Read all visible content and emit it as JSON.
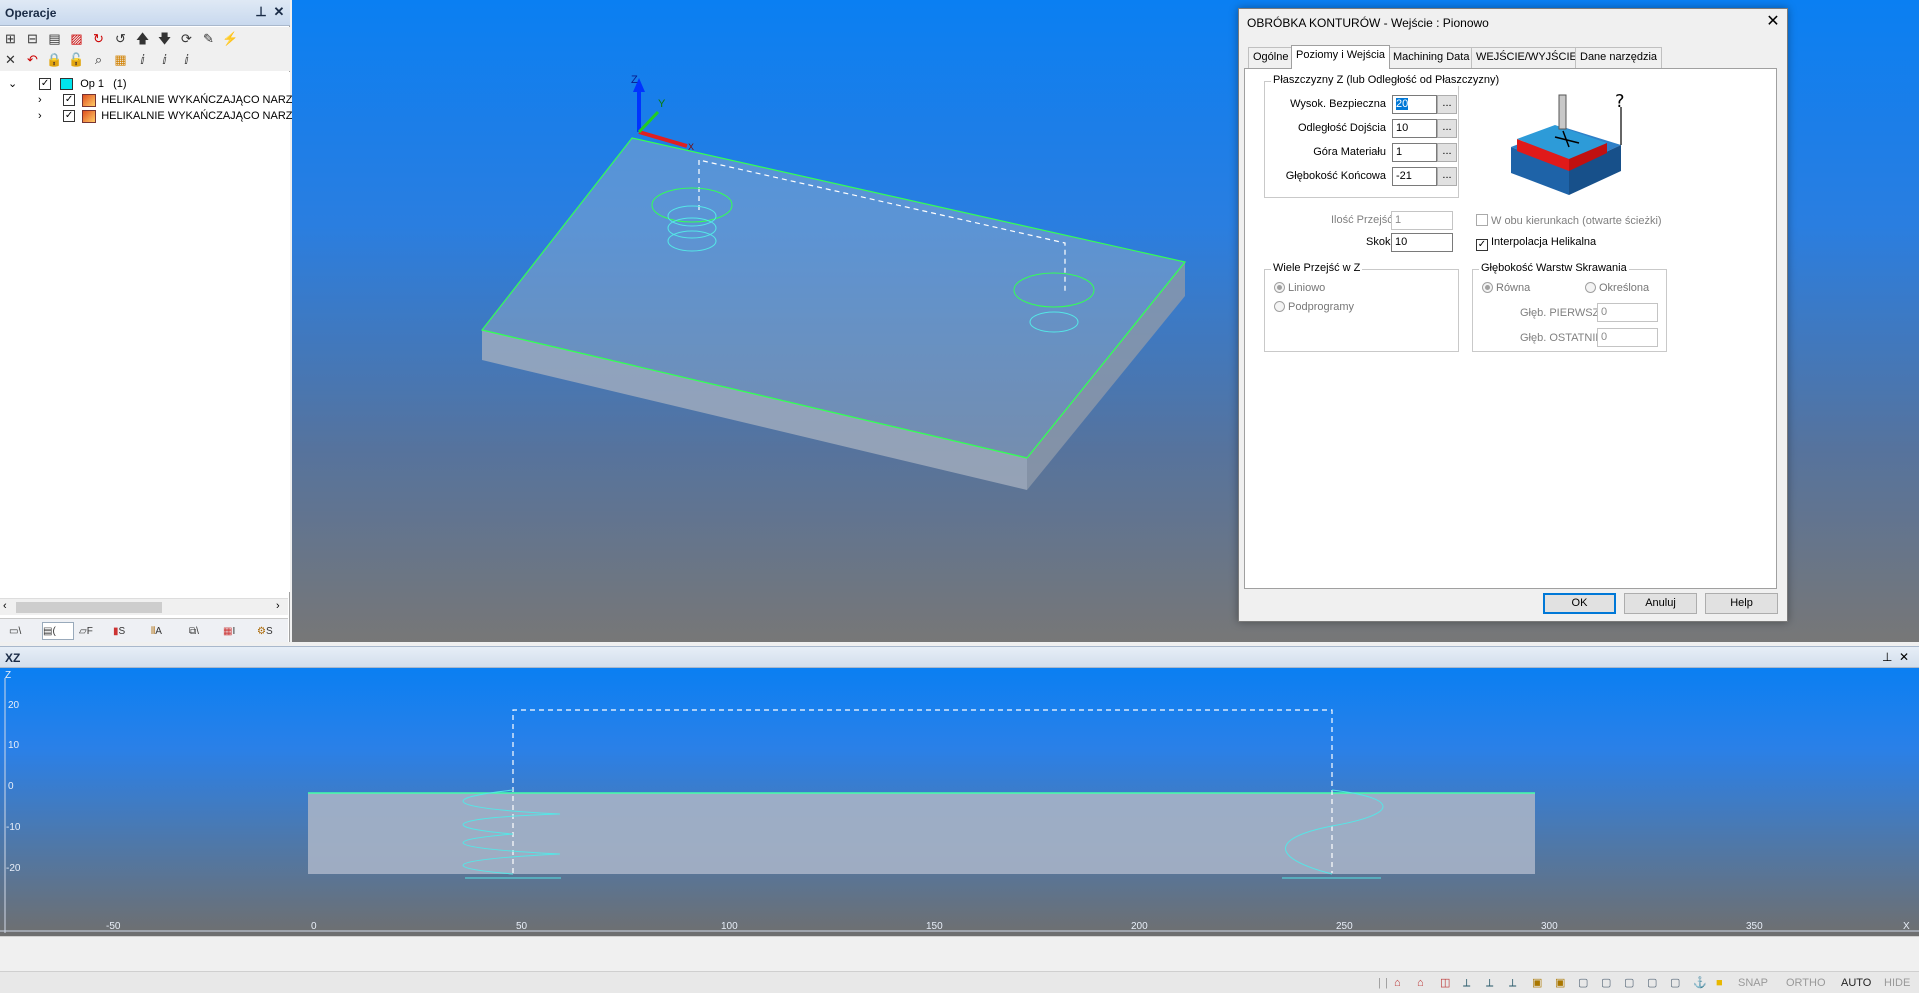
{
  "ops_panel": {
    "title": "Operacje",
    "pin_icon": "pin-icon",
    "close_icon": "close-icon",
    "tree": {
      "root_label": "Op 1",
      "root_count": "(1)",
      "children": [
        {
          "label": "HELIKALNIE WYKAŃCZAJĄCO  NARZE"
        },
        {
          "label": "HELIKALNIE WYKAŃCZAJĄCO  NARZE"
        }
      ]
    },
    "bottom_tabs": [
      "\\",
      "(",
      "F",
      "S",
      "A",
      "\\",
      "I",
      "S"
    ]
  },
  "dialog": {
    "title": "OBRÓBKA KONTURÓW - Wejście : Pionowo",
    "tabs": [
      "Ogólne",
      "Poziomy i Wejścia",
      "Machining Data",
      "WEJŚCIE/WYJŚCIE",
      "Dane narzędzia"
    ],
    "active_tab": "Poziomy i Wejścia",
    "z_planes": {
      "title": "Płaszczyzny Z (lub Odległość od Płaszczyzny)",
      "safe_height_label": "Wysok. Bezpieczna",
      "safe_height_value": "20",
      "approach_label": "Odległość Dojścia",
      "approach_value": "10",
      "top_label": "Góra Materiału",
      "top_value": "1",
      "final_depth_label": "Głębokość Końcowa",
      "final_depth_value": "-21",
      "dots_label": "..."
    },
    "passes_label": "Ilość Przejść",
    "passes_value": "1",
    "step_label": "Skok",
    "step_value": "10",
    "both_dirs_label": "W obu kierunkach (otwarte ścieżki)",
    "helical_label": "Interpolacja Helikalna",
    "multi_z": {
      "title": "Wiele Przejść w Z",
      "linear": "Liniowo",
      "subprograms": "Podprogramy"
    },
    "layers": {
      "title": "Głębokość Warstw Skrawania",
      "equal": "Równa",
      "defined": "Określona",
      "first_label": "Głęb. PIERWSZEGO",
      "first_value": "0",
      "last_label": "Głęb. OSTATNIEGO",
      "last_value": "0"
    },
    "buttons": {
      "ok": "OK",
      "cancel": "Anuluj",
      "help": "Help"
    }
  },
  "view3d": {
    "axis_z": "Z",
    "axis_y": "Y",
    "axis_x": "X"
  },
  "xz_panel": {
    "title": "XZ",
    "z_axis_label": "Z",
    "x_axis_label": "X",
    "z_ticks": [
      "20",
      "10",
      "0",
      "-10",
      "-20"
    ],
    "x_ticks": [
      "-50",
      "0",
      "50",
      "100",
      "150",
      "200",
      "250",
      "300",
      "350"
    ]
  },
  "statusbar": {
    "snap": "SNAP",
    "ortho": "ORTHO",
    "auto": "AUTO",
    "hide": "HIDE"
  },
  "colors": {
    "viewport_top": "#0a7ff2",
    "viewport_bottom": "#777777",
    "part_edge": "#33ff55",
    "toolpath": "#55e6e6"
  }
}
